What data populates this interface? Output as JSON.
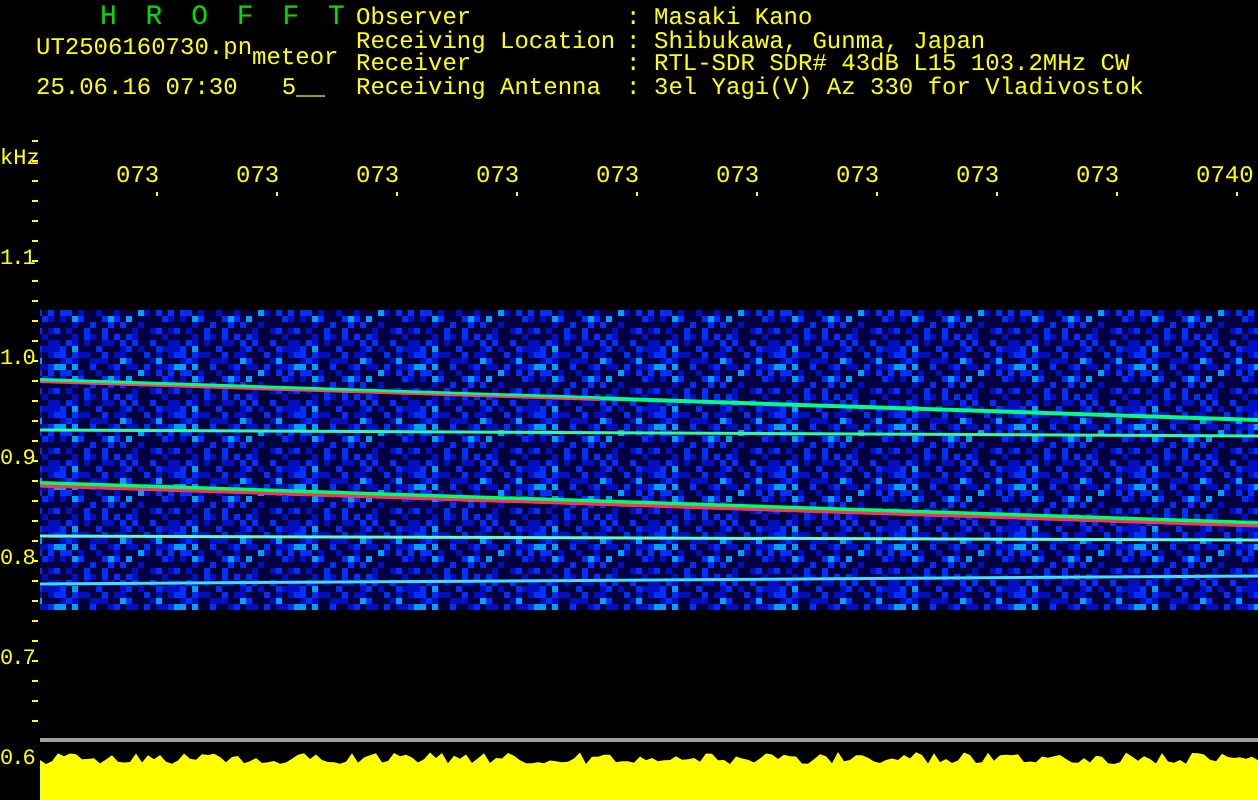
{
  "title": "H R O F F T",
  "file_name": "UT2506160730.pn",
  "file_tag": "meteor",
  "timestamp": "25.06.16 07:30",
  "count": "5__",
  "info": [
    {
      "label": "Observer",
      "separator": ":",
      "value": "Masaki Kano"
    },
    {
      "label": "Receiving Location",
      "separator": ":",
      "value": "Shibukawa, Gunma, Japan"
    },
    {
      "label": "Receiver",
      "separator": ":",
      "value": "RTL-SDR SDR# 43dB L15 103.2MHz CW"
    },
    {
      "label": "Receiving Antenna",
      "separator": ":",
      "value": "3el Yagi(V) Az 330 for Vladivostok"
    }
  ],
  "y_unit": "kHz",
  "time_labels": [
    "073",
    "073",
    "073",
    "073",
    "073",
    "073",
    "073",
    "073",
    "073",
    "0740"
  ],
  "freq_labels": [
    "1.1",
    "1.0",
    "0.9",
    "0.8",
    "0.7",
    "0.6"
  ]
}
